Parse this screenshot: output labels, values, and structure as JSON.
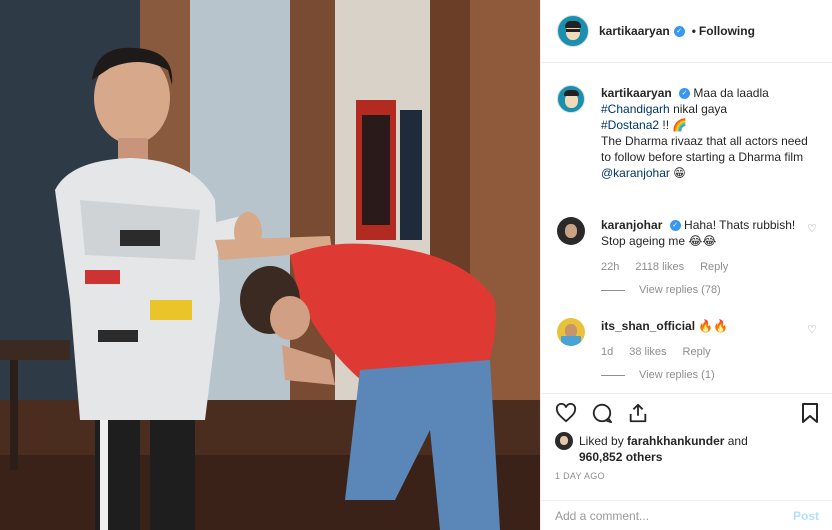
{
  "header": {
    "username": "kartikaaryan",
    "separator": "•",
    "follow_state": "Following"
  },
  "caption": {
    "username": "kartikaaryan",
    "text_1": "Maa da laadla",
    "tag_chandigarh": "#Chandigarh",
    "text_2": "nikal gaya",
    "tag_dostana": "#Dostana2",
    "text_3": "!! 🌈",
    "text_4": "The Dharma rivaaz that all actors need to follow before starting a Dharma film",
    "mention": "@karanjohar",
    "emoji": "😁"
  },
  "comments": [
    {
      "username": "karanjohar",
      "text": "Haha! Thats rubbish! Stop ageing me 😂😂",
      "time": "22h",
      "likes": "2118 likes",
      "reply": "Reply",
      "view_replies": "View replies (78)"
    },
    {
      "username": "its_shan_official",
      "text": "🔥🔥",
      "time": "1d",
      "likes": "38 likes",
      "reply": "Reply",
      "view_replies": "View replies (1)"
    }
  ],
  "likes": {
    "prefix": "Liked by",
    "by_user": "farahkhankunder",
    "and": "and",
    "others": "960,852 others"
  },
  "posted_time": "1 DAY AGO",
  "add_comment": {
    "placeholder": "Add a comment...",
    "post_label": "Post"
  },
  "colors": {
    "link": "#003569",
    "verified": "#3897f0",
    "muted": "#8e8e8e",
    "post_disabled": "#b2dffc"
  }
}
